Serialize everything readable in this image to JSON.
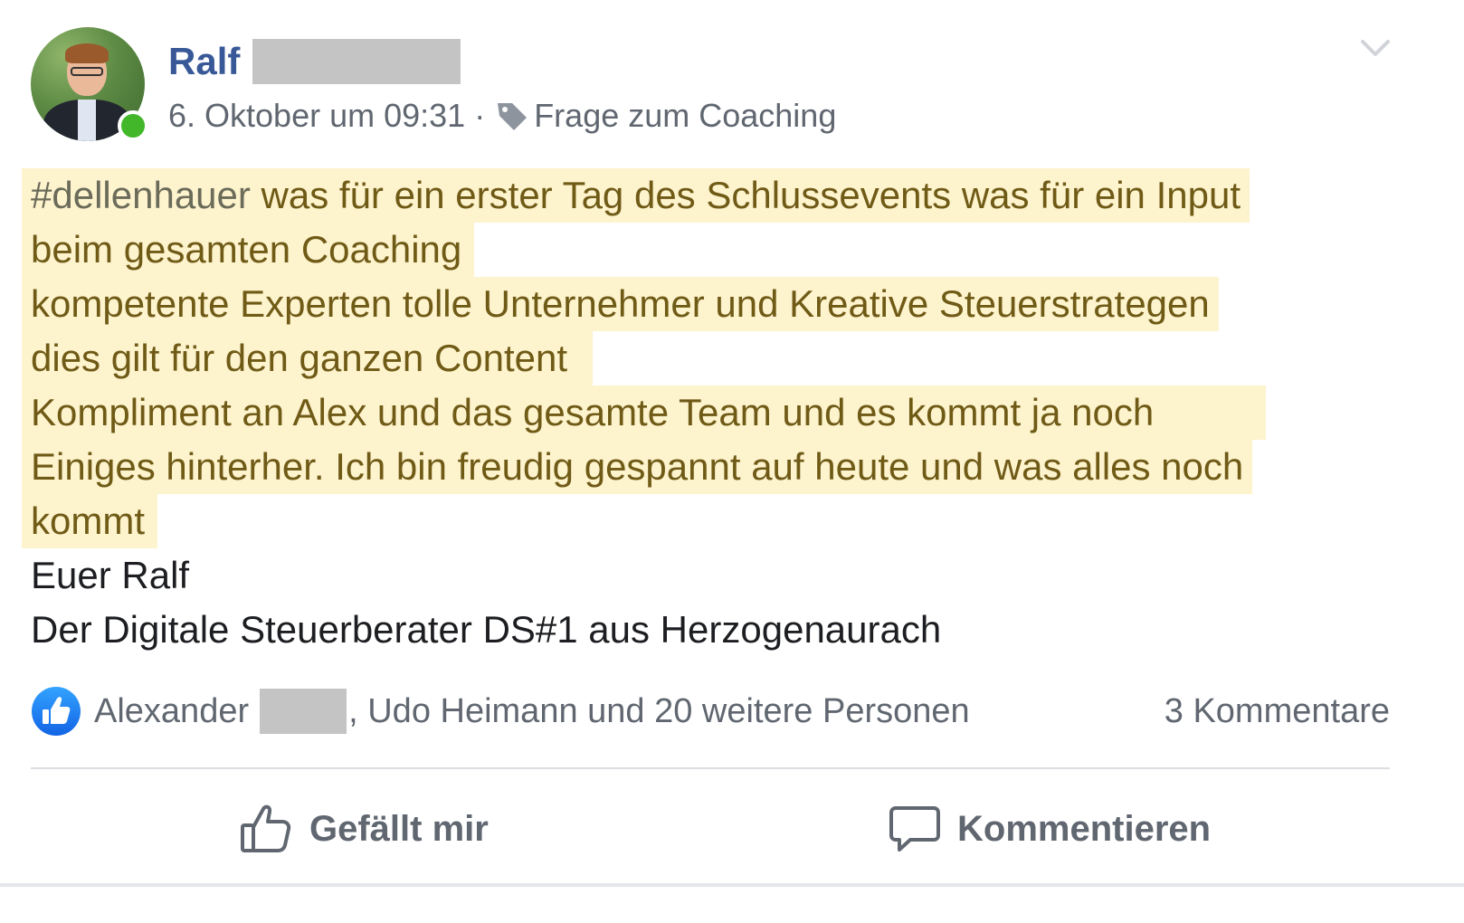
{
  "post": {
    "author": {
      "first_name": "Ralf"
    },
    "meta": {
      "timestamp": "6. Oktober um 09:31",
      "separator": "·",
      "topic": "Frage zum Coaching"
    },
    "body": {
      "hashtag": "#dellenhauer",
      "line1_rest": " was für ein erster Tag des Schlussevents was für ein Input",
      "line2": "beim gesamten Coaching",
      "line3": "kompetente Experten tolle Unternehmer und Kreative Steuerstrategen",
      "line4": "dies gilt für den ganzen Content",
      "line5": "Kompliment an Alex und das gesamte Team und es kommt ja noch",
      "line6": "Einiges hinterher. Ich bin freudig gespannt auf heute und was alles noch",
      "line7": "kommt",
      "signature1": "Euer Ralf",
      "signature2": "Der Digitale Steuerberater DS#1 aus Herzogenaurach"
    },
    "reactions": {
      "first_reactor": "Alexander",
      "others": ", Udo Heimann und 20 weitere Personen",
      "comments": "3 Kommentare"
    },
    "actions": {
      "like_label": "Gefällt mir",
      "comment_label": "Kommentieren"
    },
    "colors": {
      "author_blue": "#385898",
      "highlight_bg": "#fdf3cd",
      "highlight_text": "#6f5a16",
      "online_green": "#42b72a",
      "like_blue": "#1877f2"
    }
  }
}
